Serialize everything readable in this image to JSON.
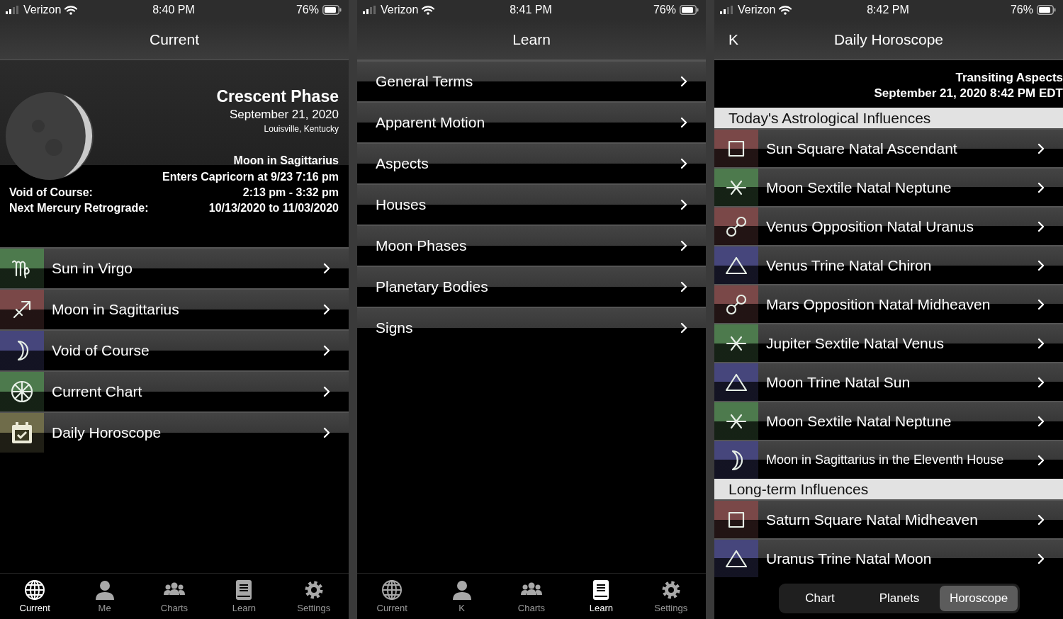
{
  "screens": [
    {
      "status_bar": {
        "carrier": "Verizon",
        "time": "8:40 PM",
        "battery": "76%"
      },
      "nav": {
        "title": "Current"
      },
      "moon_phase": {
        "title": "Crescent Phase",
        "date": "September 21, 2020",
        "location": "Louisville, Kentucky",
        "sign": "Moon in Sagittarius",
        "next_sign": "Enters Capricorn at 9/23 7:16 pm",
        "facts": [
          {
            "label": "Void of Course:",
            "value": "2:13 pm - 3:32 pm"
          },
          {
            "label": "Next Mercury Retrograde:",
            "value": "10/13/2020 to 11/03/2020"
          }
        ]
      },
      "menu": [
        {
          "label": "Sun in Virgo",
          "kind": "virgo",
          "color": "#4d7a4d"
        },
        {
          "label": "Moon in Sagittarius",
          "kind": "sagittarius",
          "color": "#7a4848"
        },
        {
          "label": "Void of Course",
          "kind": "crescent",
          "color": "#46467c"
        },
        {
          "label": "Current Chart",
          "kind": "wheel",
          "color": "#4d7a4d"
        },
        {
          "label": "Daily Horoscope",
          "kind": "calendar",
          "color": "#6f6c4a"
        }
      ],
      "tab_bar": [
        {
          "label": "Current",
          "kind": "globe",
          "selected": true
        },
        {
          "label": "Me",
          "kind": "person",
          "selected": false
        },
        {
          "label": "Charts",
          "kind": "group",
          "selected": false
        },
        {
          "label": "Learn",
          "kind": "book",
          "selected": false
        },
        {
          "label": "Settings",
          "kind": "gear",
          "selected": false
        }
      ]
    },
    {
      "status_bar": {
        "carrier": "Verizon",
        "time": "8:41 PM",
        "battery": "76%"
      },
      "nav": {
        "title": "Learn"
      },
      "menu": [
        {
          "label": "General Terms"
        },
        {
          "label": "Apparent Motion"
        },
        {
          "label": "Aspects"
        },
        {
          "label": "Houses"
        },
        {
          "label": "Moon Phases"
        },
        {
          "label": "Planetary Bodies"
        },
        {
          "label": "Signs"
        }
      ],
      "tab_bar": [
        {
          "label": "Current",
          "kind": "globe",
          "selected": false
        },
        {
          "label": "K",
          "kind": "person",
          "selected": false
        },
        {
          "label": "Charts",
          "kind": "group",
          "selected": false
        },
        {
          "label": "Learn",
          "kind": "book",
          "selected": true
        },
        {
          "label": "Settings",
          "kind": "gear",
          "selected": false
        }
      ]
    },
    {
      "status_bar": {
        "carrier": "Verizon",
        "time": "8:42 PM",
        "battery": "76%"
      },
      "nav": {
        "title": "Daily Horoscope",
        "back": "K"
      },
      "heading": {
        "title": "Transiting Aspects",
        "subtitle": "September 21, 2020 8:42 PM EDT"
      },
      "sections": [
        {
          "title": "Today's Astrological Influences",
          "items": [
            {
              "label": "Sun Square Natal Ascendant",
              "kind": "square",
              "color": "#7a4848"
            },
            {
              "label": "Moon Sextile Natal Neptune",
              "kind": "sextile",
              "color": "#4d7a4d"
            },
            {
              "label": "Venus Opposition Natal Uranus",
              "kind": "opposition",
              "color": "#7a4848"
            },
            {
              "label": "Venus Trine Natal Chiron",
              "kind": "trine",
              "color": "#46467c"
            },
            {
              "label": "Mars Opposition Natal Midheaven",
              "kind": "opposition",
              "color": "#7a4848"
            },
            {
              "label": "Jupiter Sextile Natal Venus",
              "kind": "sextile",
              "color": "#4d7a4d"
            },
            {
              "label": "Moon Trine Natal Sun",
              "kind": "trine",
              "color": "#46467c"
            },
            {
              "label": "Moon Sextile Natal Neptune",
              "kind": "sextile",
              "color": "#4d7a4d"
            },
            {
              "label": "Moon in Sagittarius in the Eleventh House",
              "kind": "crescent",
              "color": "#46467c"
            }
          ]
        },
        {
          "title": "Long-term Influences",
          "items": [
            {
              "label": "Saturn Square Natal Midheaven",
              "kind": "square",
              "color": "#7a4848"
            },
            {
              "label": "Uranus Trine Natal Moon",
              "kind": "trine",
              "color": "#46467c"
            }
          ]
        }
      ],
      "segments": [
        {
          "label": "Chart",
          "selected": false
        },
        {
          "label": "Planets",
          "selected": false
        },
        {
          "label": "Horoscope",
          "selected": true
        }
      ]
    }
  ]
}
